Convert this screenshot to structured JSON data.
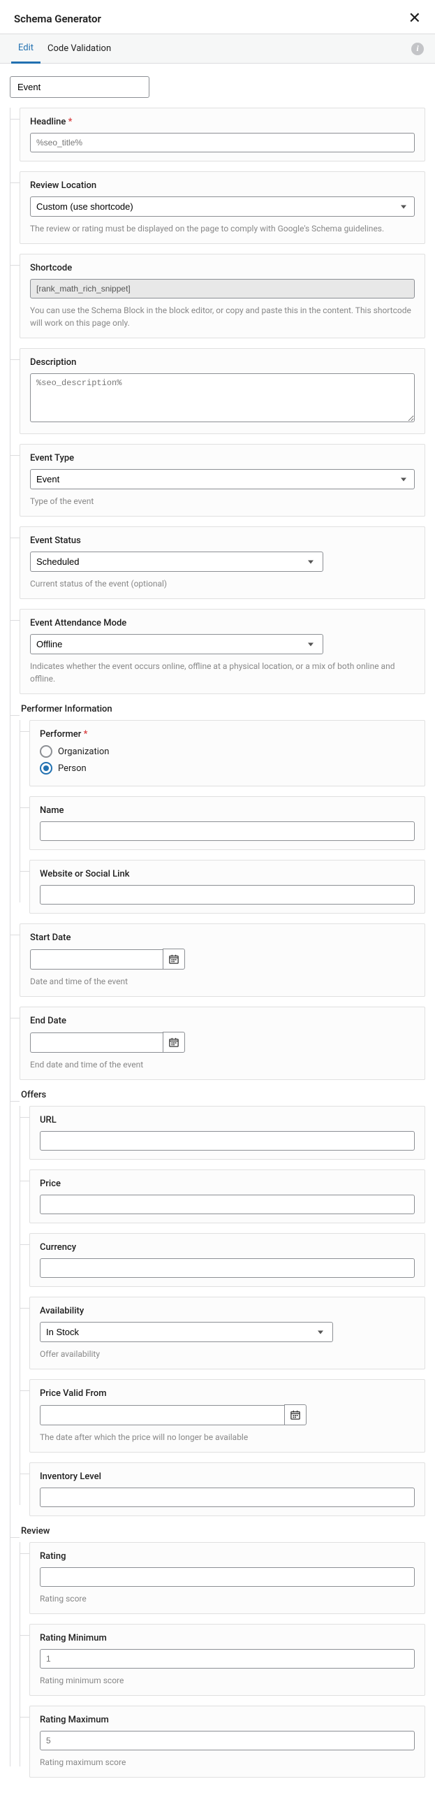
{
  "header": {
    "title": "Schema Generator"
  },
  "tabs": {
    "edit": "Edit",
    "code_validation": "Code Validation"
  },
  "type_value": "Event",
  "fields": {
    "headline": {
      "label": "Headline",
      "value": "%seo_title%"
    },
    "review_location": {
      "label": "Review Location",
      "value": "Custom (use shortcode)",
      "hint": "The review or rating must be displayed on the page to comply with Google's Schema guidelines."
    },
    "shortcode": {
      "label": "Shortcode",
      "value": "[rank_math_rich_snippet]",
      "hint": "You can use the Schema Block in the block editor, or copy and paste this in the content. This shortcode will work on this page only."
    },
    "description": {
      "label": "Description",
      "value": "%seo_description%"
    },
    "event_type": {
      "label": "Event Type",
      "value": "Event",
      "hint": "Type of the event"
    },
    "event_status": {
      "label": "Event Status",
      "value": "Scheduled",
      "hint": "Current status of the event (optional)"
    },
    "attendance": {
      "label": "Event Attendance Mode",
      "value": "Offline",
      "hint": "Indicates whether the event occurs online, offline at a physical location, or a mix of both online and offline."
    }
  },
  "performer": {
    "section": "Performer Information",
    "head": "Performer",
    "org": "Organization",
    "person": "Person",
    "name_label": "Name",
    "website_label": "Website or Social Link"
  },
  "dates": {
    "start": {
      "label": "Start Date",
      "hint": "Date and time of the event"
    },
    "end": {
      "label": "End Date",
      "hint": "End date and time of the event"
    }
  },
  "offers": {
    "section": "Offers",
    "url": "URL",
    "price": "Price",
    "currency": "Currency",
    "availability": {
      "label": "Availability",
      "value": "In Stock",
      "hint": "Offer availability"
    },
    "valid_from": {
      "label": "Price Valid From",
      "hint": "The date after which the price will no longer be available"
    },
    "inventory": "Inventory Level"
  },
  "review": {
    "section": "Review",
    "rating": {
      "label": "Rating",
      "hint": "Rating score"
    },
    "min": {
      "label": "Rating Minimum",
      "value": "1",
      "hint": "Rating minimum score"
    },
    "max": {
      "label": "Rating Maximum",
      "value": "5",
      "hint": "Rating maximum score"
    }
  }
}
